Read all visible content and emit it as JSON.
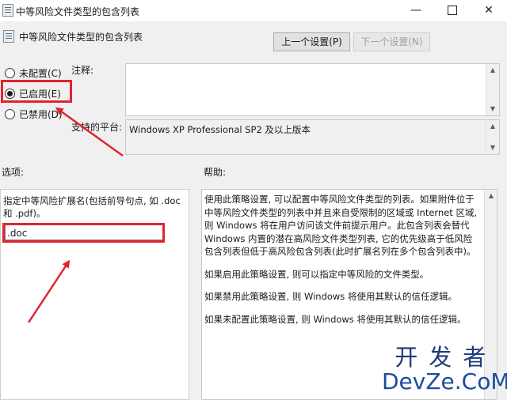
{
  "window": {
    "title": "中等风险文件类型的包含列表",
    "minimize_glyph": "—",
    "close_glyph": "✕"
  },
  "header": {
    "policy_title": "中等风险文件类型的包含列表",
    "prev_button": "上一个设置(P)",
    "next_button": "下一个设置(N)"
  },
  "state": {
    "not_configured": "未配置(C)",
    "enabled": "已启用(E)",
    "disabled": "已禁用(D)",
    "selected": "enabled"
  },
  "comment": {
    "label": "注释:",
    "value": ""
  },
  "platform": {
    "label": "支持的平台:",
    "value": "Windows XP Professional SP2 及以上版本"
  },
  "options": {
    "label": "选项:",
    "description": "指定中等风险扩展名(包括前导句点, 如 .doc 和 .pdf)。",
    "extension_value": ".doc"
  },
  "help": {
    "label": "帮助:",
    "paragraphs": [
      "使用此策略设置, 可以配置中等风险文件类型的列表。如果附件位于中等风险文件类型的列表中并且来自受限制的区域或 Internet 区域, 则 Windows 将在用户访问该文件前提示用户。此包含列表会替代 Windows 内置的潜在高风险文件类型列表, 它的优先级高于低风险包含列表但低于高风险包含列表(此时扩展名列在多个包含列表中)。",
      "如果启用此策略设置, 则可以指定中等风险的文件类型。",
      "如果禁用此策略设置, 则 Windows 将使用其默认的信任逻辑。",
      "如果未配置此策略设置, 则 Windows 将使用其默认的信任逻辑。"
    ]
  },
  "watermark": {
    "top": "开发者",
    "bottom": "DevZe.CoM"
  },
  "colors": {
    "annotation_red": "#e0252f",
    "watermark_blue": "#1f4aa0"
  }
}
